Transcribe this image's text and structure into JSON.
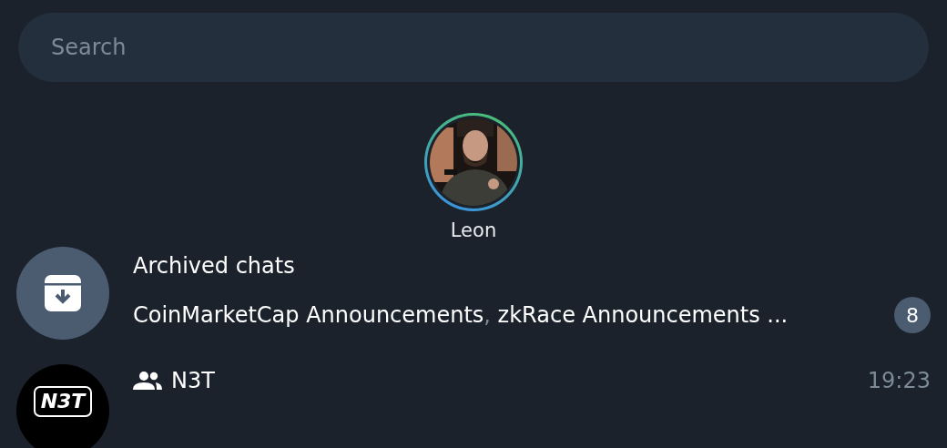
{
  "search": {
    "placeholder": "Search"
  },
  "stories": [
    {
      "name": "Leon",
      "unread": true,
      "kind": "picture"
    }
  ],
  "archived": {
    "title": "Archived chats",
    "chats": [
      "CoinMarketCap Announcements",
      "zkRace Announcements ..."
    ],
    "separator": ", ",
    "badge": "8"
  },
  "chats": [
    {
      "name": "N3T",
      "kind": "group",
      "time": "19:23",
      "avatar_text": "N3T"
    }
  ]
}
